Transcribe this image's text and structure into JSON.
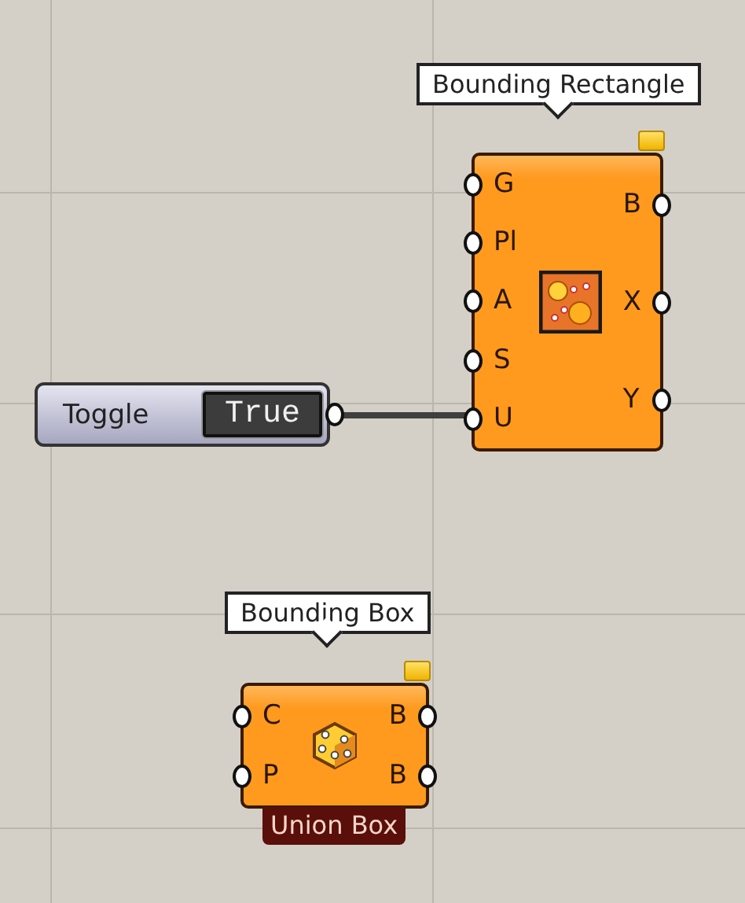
{
  "components": [
    {
      "kind": "toggle",
      "label": "Toggle",
      "value": "True"
    },
    {
      "kind": "node",
      "tooltip": "Bounding Rectangle",
      "inputs": [
        "G",
        "Pl",
        "A",
        "S",
        "U"
      ],
      "outputs": [
        "B",
        "X",
        "Y"
      ],
      "flag": true
    },
    {
      "kind": "node",
      "tooltip": "Bounding Box",
      "inputs": [
        "C",
        "P"
      ],
      "outputs": [
        "B",
        "B"
      ],
      "flag": true,
      "caption": "Union Box"
    }
  ]
}
